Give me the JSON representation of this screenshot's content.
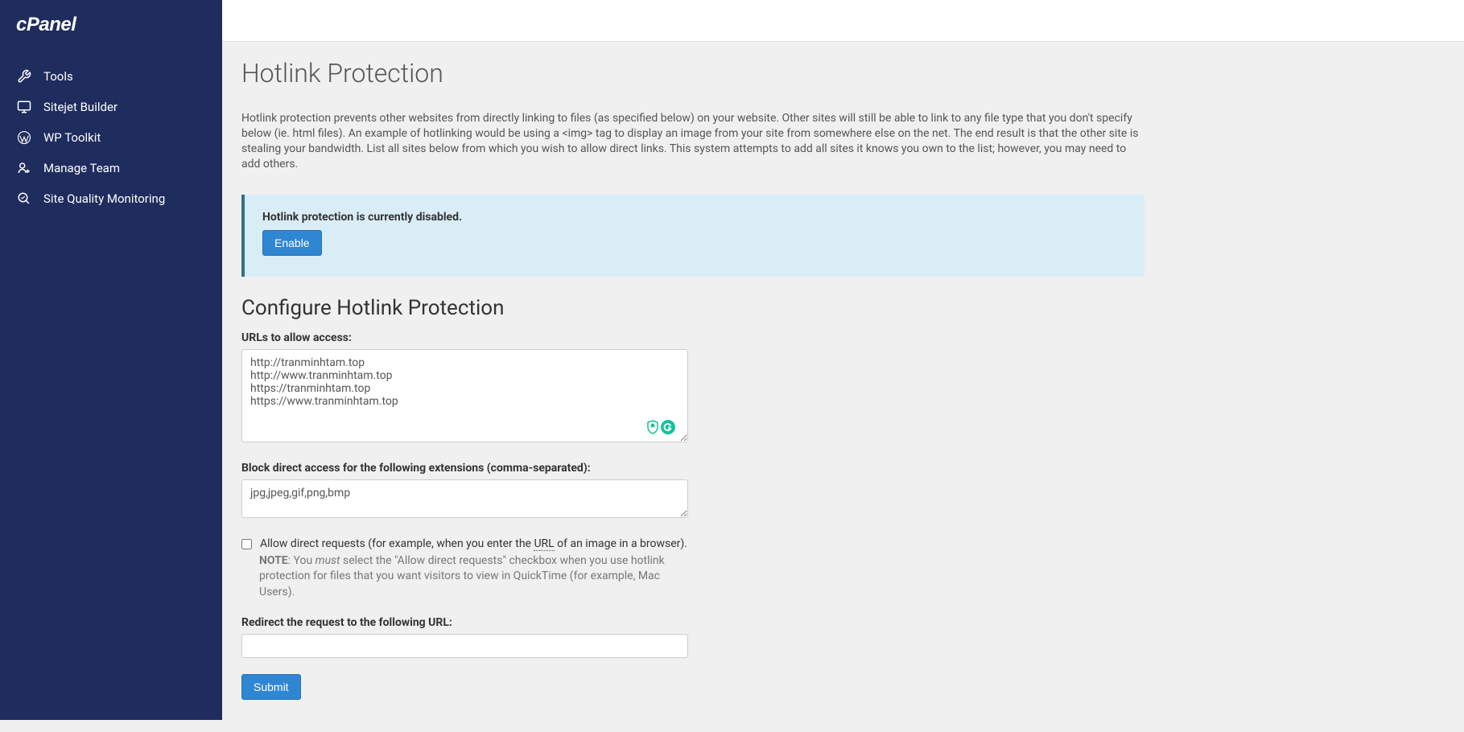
{
  "brand": "cPanel",
  "sidebar": {
    "items": [
      {
        "label": "Tools",
        "icon": "tools-icon"
      },
      {
        "label": "Sitejet Builder",
        "icon": "sitejet-icon"
      },
      {
        "label": "WP Toolkit",
        "icon": "wordpress-icon"
      },
      {
        "label": "Manage Team",
        "icon": "team-icon"
      },
      {
        "label": "Site Quality Monitoring",
        "icon": "quality-icon"
      }
    ]
  },
  "page": {
    "title": "Hotlink Protection",
    "description": "Hotlink protection prevents other websites from directly linking to files (as specified below) on your website. Other sites will still be able to link to any file type that you don't specify below (ie. html files). An example of hotlinking would be using a <img> tag to display an image from your site from somewhere else on the net. The end result is that the other site is stealing your bandwidth. List all sites below from which you wish to allow direct links. This system attempts to add all sites it knows you own to the list; however, you may need to add others."
  },
  "alert": {
    "status_text": "Hotlink protection is currently disabled.",
    "enable_label": "Enable"
  },
  "config": {
    "section_title": "Configure Hotlink Protection",
    "urls_label": "URLs to allow access:",
    "urls_value": "http://tranminhtam.top\nhttp://www.tranminhtam.top\nhttps://tranminhtam.top\nhttps://www.tranminhtam.top",
    "extensions_label": "Block direct access for the following extensions (comma-separated):",
    "extensions_value": "jpg,jpeg,gif,png,bmp",
    "allow_direct_prefix": "Allow direct requests (for example, when you enter the ",
    "allow_direct_url_abbr": "URL",
    "allow_direct_suffix": " of an image in a browser).",
    "note_label": "NOTE",
    "note_prefix": ": You ",
    "note_must": "must",
    "note_suffix": " select the \"Allow direct requests\" checkbox when you use hotlink protection for files that you want visitors to view in QuickTime (for example, Mac Users).",
    "redirect_label": "Redirect the request to the following URL:",
    "redirect_value": "",
    "submit_label": "Submit"
  }
}
